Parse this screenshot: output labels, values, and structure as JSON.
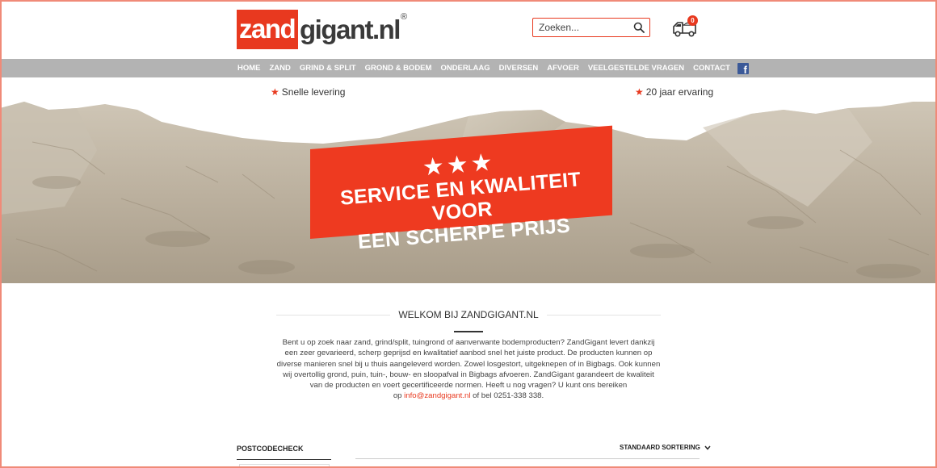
{
  "header": {
    "logo": {
      "part1": "zand",
      "part2": "gigant.nl",
      "reg": "®"
    },
    "search": {
      "placeholder": "Zoeken..."
    },
    "cart": {
      "count": "0"
    }
  },
  "nav": {
    "items": [
      "HOME",
      "ZAND",
      "GRIND & SPLIT",
      "GROND & BODEM",
      "ONDERLAAG",
      "DIVERSEN",
      "AFVOER",
      "VEELGESTELDE VRAGEN",
      "CONTACT"
    ],
    "facebook": "f"
  },
  "hero": {
    "usp_left": "Snelle levering",
    "usp_right": "20 jaar ervaring",
    "banner_stars": "★★★",
    "banner_line1": "SERVICE EN KWALITEIT VOOR",
    "banner_line2": "EEN SCHERPE PRIJS"
  },
  "welcome": {
    "title": "WELKOM BIJ ZANDGIGANT.NL",
    "text": "Bent u op zoek naar zand, grind/split, tuingrond of aanverwante bodemproducten? ZandGigant levert dankzij een zeer gevarieerd, scherp geprijsd en kwalitatief aanbod snel het juiste product. De producten kunnen op diverse manieren snel bij u thuis aangeleverd worden. Zowel losgestort, uitgeknepen of in Bigbags. Ook kunnen wij overtollig grond, puin, tuin-, bouw- en sloopafval in Bigbags afvoeren. ZandGigant garandeert de kwaliteit van de producten en voert gecertificeerde normen. Heeft u nog vragen? U kunt ons bereiken",
    "contact_prefix": "op",
    "email": "info@zandgigant.nl",
    "contact_suffix": "of bel 0251-338 338."
  },
  "sidebar": {
    "postcode_title": "POSTCODECHECK"
  },
  "shop": {
    "sort_label": "STANDAARD SORTERING"
  },
  "colors": {
    "accent": "#e8391f",
    "nav_bg": "#b3b3b3",
    "facebook": "#3b5998"
  },
  "icons": [
    "search-icon",
    "cart-truck-icon",
    "facebook-icon",
    "star-icon",
    "chevron-down-icon"
  ]
}
